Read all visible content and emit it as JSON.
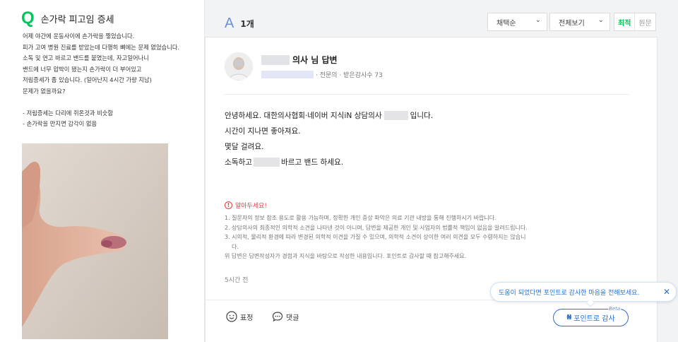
{
  "question": {
    "title": "손가락 피고임 증세",
    "body": "어제 야간에 운동사이에 손가락을 찧었습니다.\n피가 고여 병원 진료를 받았는데 다행히 뼈에는 문제 없었습니다.\n소독 및 연고 바르고 밴드를 붙였는데, 자고일어나니\n밴드에 너무 압박이 됐는지 손가락이 더 부어있고\n저림증세가 좀 있습니다. (일어난지 4시간 가량 지남)\n문제가 없을까요?\n\n- 저림증세는 다리에 쥐온것과 비슷함\n- 손가락을 만지면 감각이 없음"
  },
  "answers_header": {
    "icon": "A",
    "count": "1개",
    "filter1": "채택순",
    "filter2": "전체보기",
    "sort_latest": "최적",
    "sort_original": "원문"
  },
  "answer": {
    "name_suffix": "의사 님 답변",
    "meta": "· 전문의  · 받은감사수 73",
    "line1_a": "안녕하세요. 대한의사협회·네이버 지식iN 상담의사",
    "line1_b": "입니다.",
    "line2": "시간이 지나면 좋아져요.",
    "line3": "몇달 걸려요.",
    "line4_a": "소독하고",
    "line4_b": "바르고 밴드 하세요.",
    "notice_title": "알아두세요!",
    "notice_1": "1. 질문자의 정보 참조 용도로 활용 가능하며, 정확한 개인 증상 파악은 의료 기관 내방을 통해 진행하시기 바랍니다.",
    "notice_2": "2. 상담의사의 최종적인 의학적 소견을 나타낸 것이 아니며, 답변을 제공한 개인 및 사업자의 법률적 책임이 없음을 알려드립니다.",
    "notice_3": "3. 시의적, 물리적 환경에 따라 변경된 의학적 이견을 가질 수 있으며, 의학적 소견이 상이한 여러 의견을 모두 수렴하지는 않습니",
    "notice_3b": "다.",
    "notice_4": "위 답변은 답변작성자가 경험과 지식을 바탕으로 작성한 내용입니다. 포인트로 감사할 때 참고해주세요.",
    "time": "5시간 전"
  },
  "footer": {
    "like": "표정",
    "comment": "댓글",
    "tooltip": "도움이 되었다면 포인트로 감사한 마음을 전해보세요.",
    "tooltip_close": "✕",
    "points_icon": "₦",
    "points_label": "포인트로 감사",
    "beta": "Beta"
  },
  "colors": {
    "green": "#03c75a",
    "blue": "#2a6fd1",
    "warn": "#e53e3e"
  }
}
